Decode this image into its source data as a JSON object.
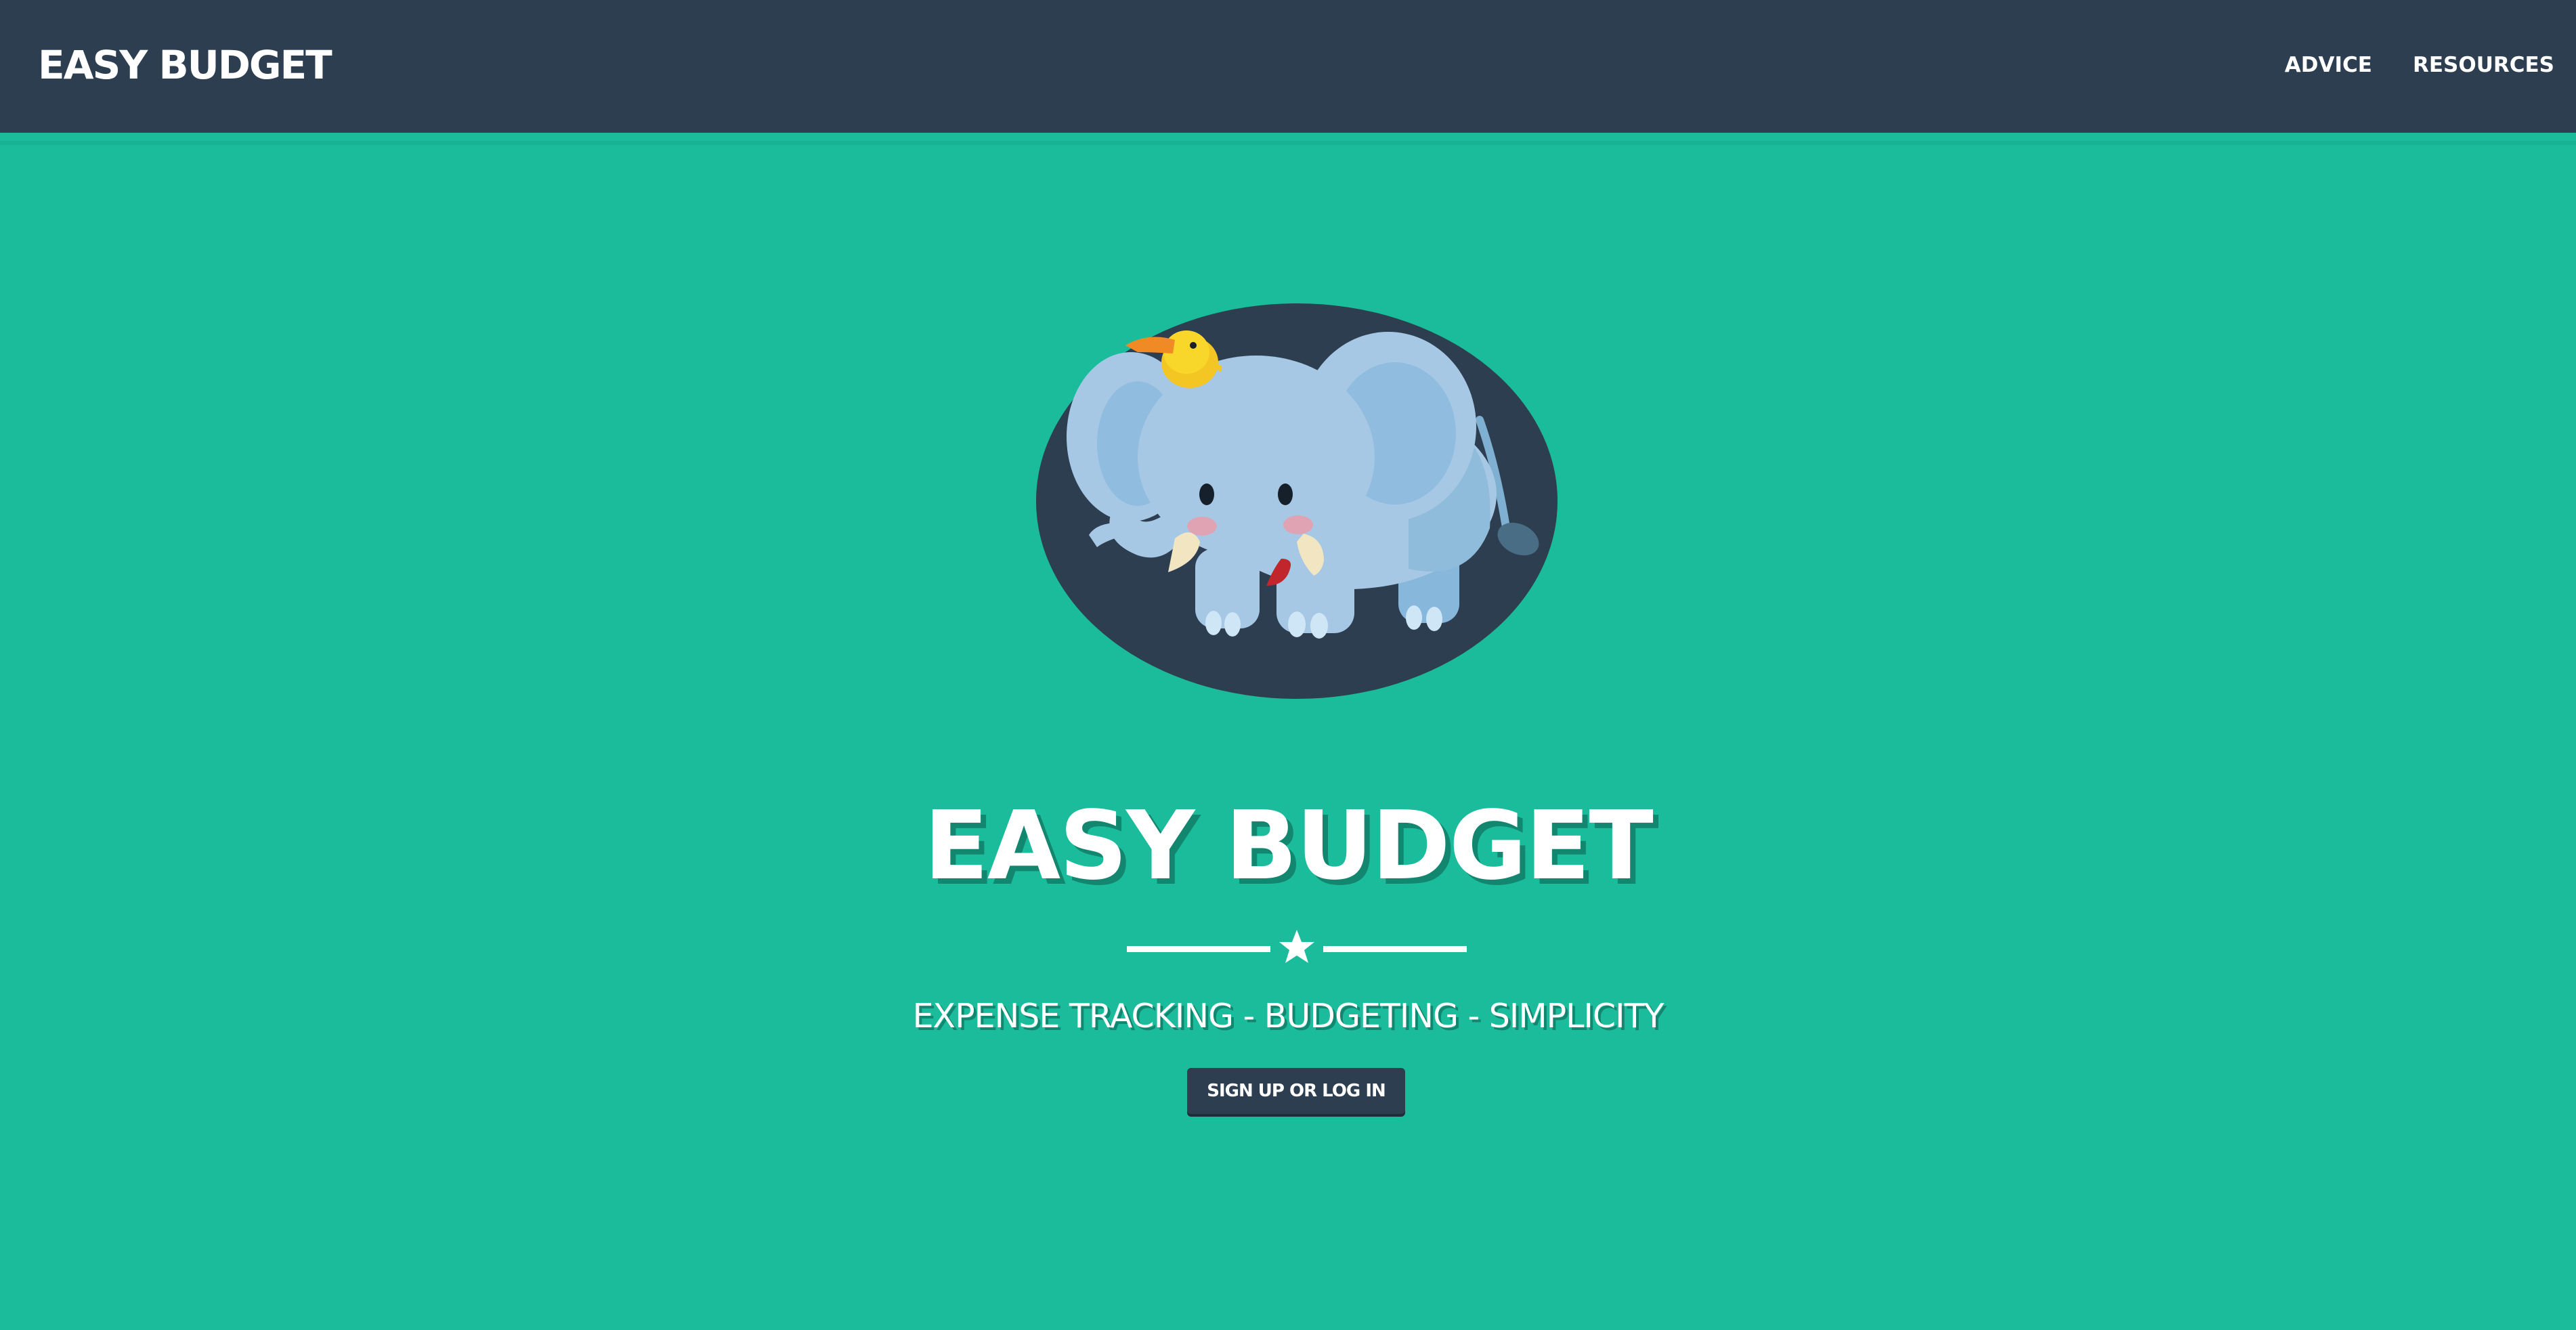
{
  "navbar": {
    "brand": "EASY BUDGET",
    "links": [
      {
        "label": "ADVICE"
      },
      {
        "label": "RESOURCES"
      }
    ]
  },
  "hero": {
    "image_icon": "elephant-with-bird-illustration",
    "title": "EASY BUDGET",
    "divider_icon": "star-icon",
    "tagline": "EXPENSE TRACKING - BUDGETING - SIMPLICITY",
    "cta_label": "SIGN UP OR LOG IN"
  },
  "colors": {
    "background": "#1abc9c",
    "navbar": "#2c3e50",
    "button": "#2c3e50",
    "text": "#ffffff"
  }
}
